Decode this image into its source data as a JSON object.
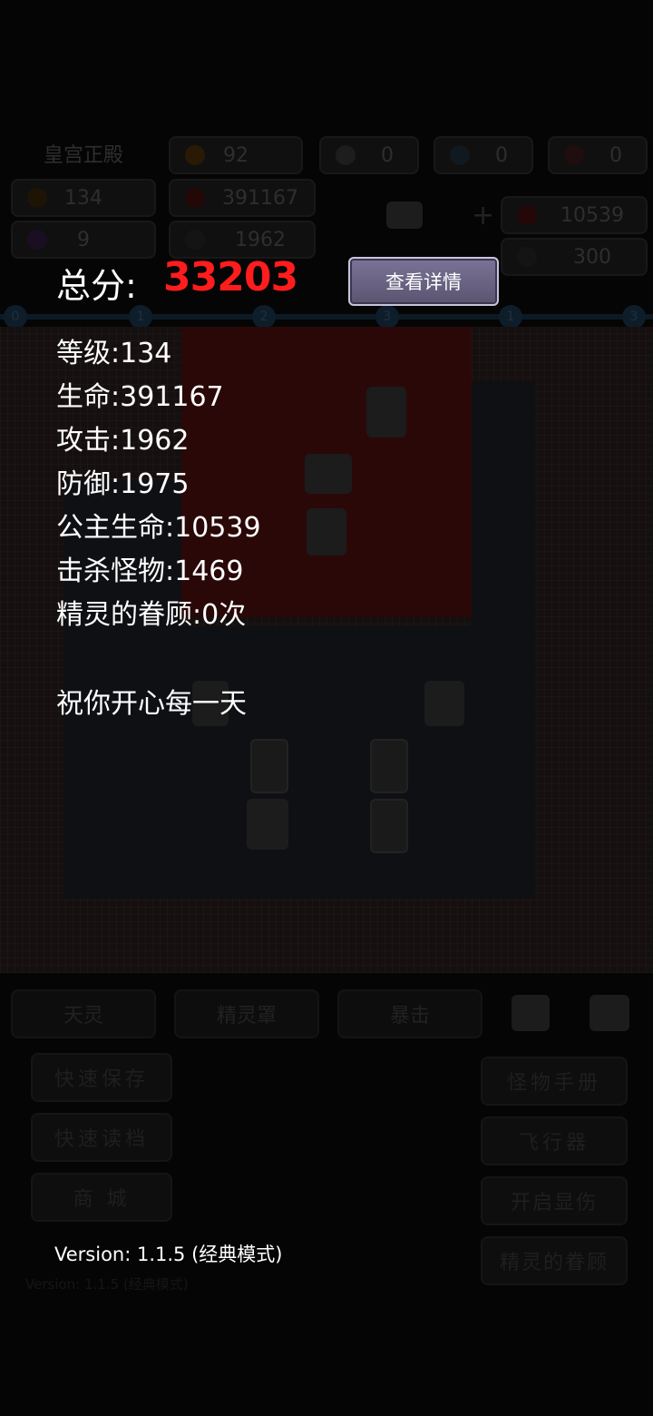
{
  "background": {
    "location": "皇宫正殿",
    "top_stats": {
      "gold": "92",
      "key1": "0",
      "key2": "0",
      "key3": "0",
      "level": "134",
      "hp": "391167",
      "gem": "9",
      "attack": "1962",
      "princess_hp": "10539",
      "defense_partial": "300"
    },
    "track_nodes": [
      "0",
      "1",
      "2",
      "3",
      "1",
      "3"
    ],
    "skill_buttons": [
      "天灵",
      "精灵罩",
      "暴击"
    ],
    "left_buttons": [
      "快速保存",
      "快速读档",
      "商 城"
    ],
    "right_buttons": [
      "怪物手册",
      "飞行器",
      "开启显伤",
      "精灵的眷顾"
    ],
    "ghost_version": "Version: 1.1.5 (经典模式)"
  },
  "overlay": {
    "score_label": "总分:",
    "score_value": "33203",
    "detail_button": "查看详情",
    "stats": [
      "等级:134",
      "生命:391167",
      "攻击:1962",
      "防御:1975",
      "公主生命:10539",
      "击杀怪物:1469",
      "精灵的眷顾:0次"
    ],
    "blessing": "祝你开心每一天",
    "version": "Version: 1.1.5 (经典模式)"
  },
  "colors": {
    "score": "#ff1c1c",
    "button": "#6b6585",
    "background": "#050505"
  }
}
